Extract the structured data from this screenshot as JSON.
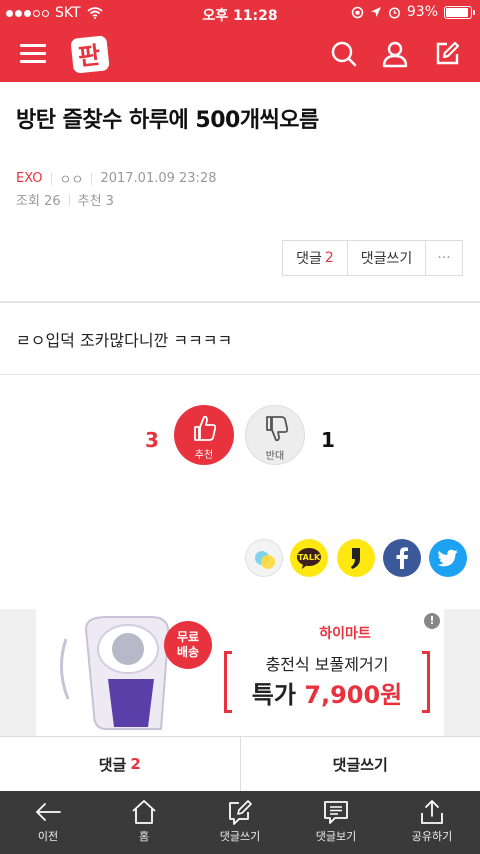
{
  "status_bar": {
    "carrier": "SKT",
    "time": "오후 11:28",
    "battery_text": "93%",
    "battery_level": 0.93
  },
  "header": {
    "logo_text": "판",
    "icons": [
      "menu-icon",
      "search-icon",
      "user-icon",
      "write-icon"
    ]
  },
  "post": {
    "title": "방탄 즐찾수 하루에 500개씩오름",
    "category": "EXO",
    "author": "ㅇㅇ",
    "datetime": "2017.01.09 23:28",
    "views": "조회 26",
    "recommends": "추천 3",
    "body": "ㄹㅇ입덕 조카많다니깐 ㅋㅋㅋㅋ"
  },
  "actions": {
    "comment_label": "댓글",
    "comment_count": "2",
    "write_label": "댓글쓰기",
    "more_label": "···"
  },
  "vote": {
    "up_count": "3",
    "up_label": "추천",
    "down_count": "1",
    "down_label": "반대"
  },
  "share": {
    "talk_label": "TALK"
  },
  "ad": {
    "badge": "!",
    "free_line1": "무료",
    "free_line2": "배송",
    "brand": "하이마트",
    "line1": "충전식 보풀제거기",
    "line2_prefix": "특가 ",
    "line2_price": "7,900원"
  },
  "comment_bar": {
    "comment_label": "댓글",
    "comment_count": "2",
    "write_label": "댓글쓰기"
  },
  "nav": {
    "items": [
      {
        "label": "이전",
        "icon": "back-arrow-icon"
      },
      {
        "label": "홈",
        "icon": "home-icon"
      },
      {
        "label": "댓글쓰기",
        "icon": "write-comment-icon"
      },
      {
        "label": "댓글보기",
        "icon": "view-comments-icon"
      },
      {
        "label": "공유하기",
        "icon": "share-icon"
      }
    ]
  },
  "colors": {
    "brand_red": "#e8333f",
    "nav_bg": "#3a3a3a",
    "facebook": "#3b5998",
    "twitter": "#1da1f2",
    "kakao_yellow": "#ffe812"
  }
}
